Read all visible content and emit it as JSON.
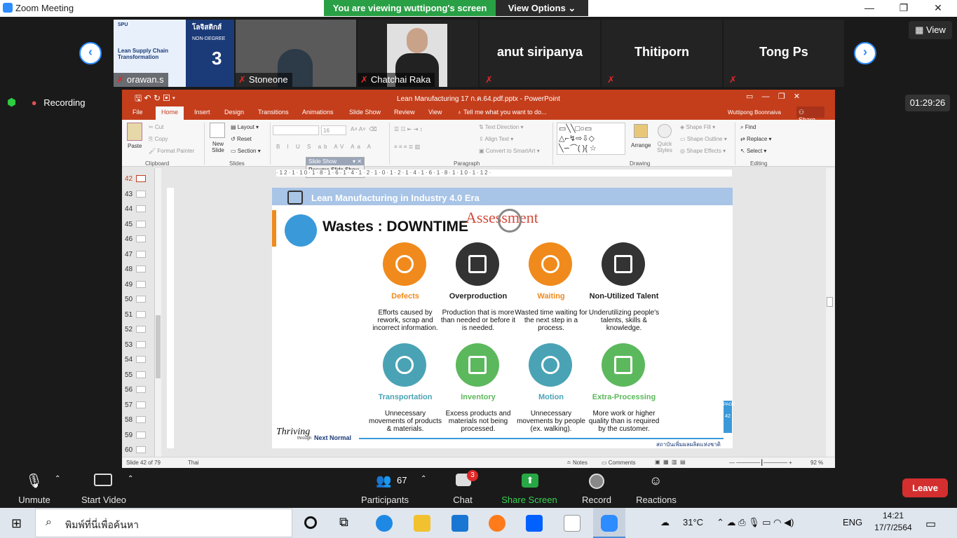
{
  "window": {
    "app_title": "Zoom Meeting",
    "banner": "You are viewing wuttipong's screen",
    "view_options": "View Options ⌄"
  },
  "gallery": {
    "participants": [
      {
        "name": "orawan.s"
      },
      {
        "name": "Stoneone"
      },
      {
        "name": "Chatchai Raka"
      },
      {
        "name": "anut siripanya"
      },
      {
        "name": "Thitiporn"
      },
      {
        "name": "Tong Ps"
      }
    ],
    "tile_slide": {
      "brand": "SPU",
      "title_th": "โลจิสติกส์",
      "line2": "NON-DEGREE",
      "line3": "Lean Supply Chain Transformation",
      "number": "3"
    },
    "view_label": "View"
  },
  "recording": {
    "label": "Recording",
    "timer": "01:29:26"
  },
  "ppt": {
    "title": "Lean Manufacturing 17 ก.ค.64.pdf.pptx - PowerPoint",
    "tabs": [
      "File",
      "Home",
      "Insert",
      "Design",
      "Transitions",
      "Animations",
      "Slide Show",
      "Review",
      "View"
    ],
    "tellme": "Tell me what you want to do...",
    "user": "Wuttipong Boonnaiva",
    "share": "Share",
    "ribbon": {
      "paste": "Paste",
      "cut": "Cut",
      "copy": "Copy",
      "format_painter": "Format Painter",
      "new_slide": "New Slide",
      "layout": "Layout",
      "reset": "Reset",
      "section": "Section",
      "font_size": "16",
      "text_direction": "Text Direction",
      "align_text": "Align Text",
      "convert": "Convert to SmartArt",
      "arrange": "Arrange",
      "quick_styles": "Quick Styles",
      "shape_fill": "Shape Fill",
      "shape_outline": "Shape Outline",
      "shape_effects": "Shape Effects",
      "find": "Find",
      "replace": "Replace",
      "select": "Select",
      "groups": [
        "Clipboard",
        "Slides",
        "Paragraph",
        "Drawing",
        "Editing"
      ]
    },
    "slideshow_pop": {
      "label": "Slide Show",
      "resume": "Resume Slide Show"
    },
    "thumbs": [
      "42",
      "43",
      "44",
      "45",
      "46",
      "47",
      "48",
      "49",
      "50",
      "51",
      "52",
      "53",
      "54",
      "55",
      "56",
      "57",
      "58",
      "59",
      "60"
    ],
    "ruler": "·12·1·10·1·8·1·6·1·4·1·2·1·0·1·2·1·4·1·6·1·8·1·10·1·12·",
    "status": {
      "slide": "Slide 42 of 79",
      "lang": "Thai",
      "notes": "Notes",
      "comments": "Comments",
      "zoom": "92 %"
    }
  },
  "slide": {
    "header": "Lean Manufacturing in Industry 4.0 Era",
    "title": "Wastes : DOWNTIME",
    "stamp": "Assessment",
    "page_label": "PAGE",
    "page_no": "42",
    "footer_left": "Thriving",
    "footer_through": "through",
    "footer_next": "Next Normal",
    "footer_right": "สถาบันเพิ่มผลผลิตแห่งชาติ",
    "wastes": [
      {
        "label": "Defects",
        "desc": "Efforts caused by rework, scrap and incorrect information.",
        "color": "#f08a1c"
      },
      {
        "label": "Overproduction",
        "desc": "Production that is more than needed or before it is needed.",
        "color": "#333333"
      },
      {
        "label": "Waiting",
        "desc": "Wasted time waiting for the next step in a process.",
        "color": "#f08a1c"
      },
      {
        "label": "Non-Utilized Talent",
        "desc": "Underutilizing people's talents, skills & knowledge.",
        "color": "#333333"
      },
      {
        "label": "Transportation",
        "desc": "Unnecessary movements of products & materials.",
        "color": "#4aa3b5"
      },
      {
        "label": "Inventory",
        "desc": "Excess products and materials not being processed.",
        "color": "#5cb85c"
      },
      {
        "label": "Motion",
        "desc": "Unnecessary movements by people (ex. walking).",
        "color": "#4aa3b5"
      },
      {
        "label": "Extra-Processing",
        "desc": "More work or higher quality than is required by the customer.",
        "color": "#5cb85c"
      }
    ]
  },
  "controls": {
    "unmute": "Unmute",
    "video": "Start Video",
    "participants": "Participants",
    "participants_count": "67",
    "chat": "Chat",
    "chat_badge": "3",
    "share": "Share Screen",
    "record": "Record",
    "reactions": "Reactions",
    "leave": "Leave"
  },
  "taskbar": {
    "search_placeholder": "พิมพ์ที่นี่เพื่อค้นหา",
    "temp": "31°C",
    "lang": "ENG",
    "time": "14:21",
    "date": "17/7/2564"
  }
}
